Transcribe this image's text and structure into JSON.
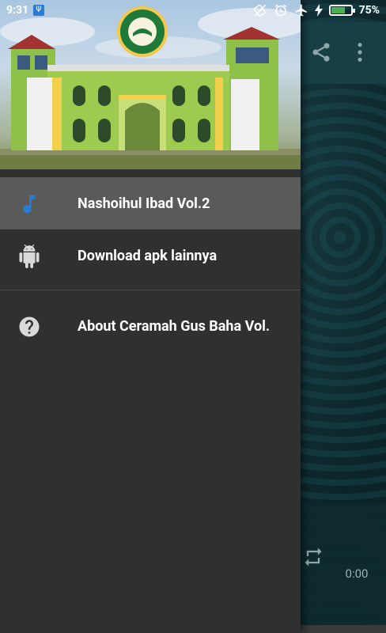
{
  "status_bar": {
    "time": "9:31",
    "battery_percent": "75%",
    "battery_level": 0.75
  },
  "drawer": {
    "menu_items": [
      {
        "label": "Nashoihul Ibad Vol.2",
        "icon": "music-note-icon",
        "active": true
      },
      {
        "label": "Download apk lainnya",
        "icon": "android-icon",
        "active": false
      },
      {
        "label": "About Ceramah Gus Baha Vol.",
        "icon": "help-circle-icon",
        "active": false
      }
    ]
  },
  "player": {
    "elapsed_time": "0:00"
  },
  "colors": {
    "drawer_bg": "#303030",
    "active_item_bg": "#5a5a5a",
    "toolbar_bg": "#173f45",
    "accent_blue": "#2a7bd6",
    "battery_green": "#4caf50"
  }
}
